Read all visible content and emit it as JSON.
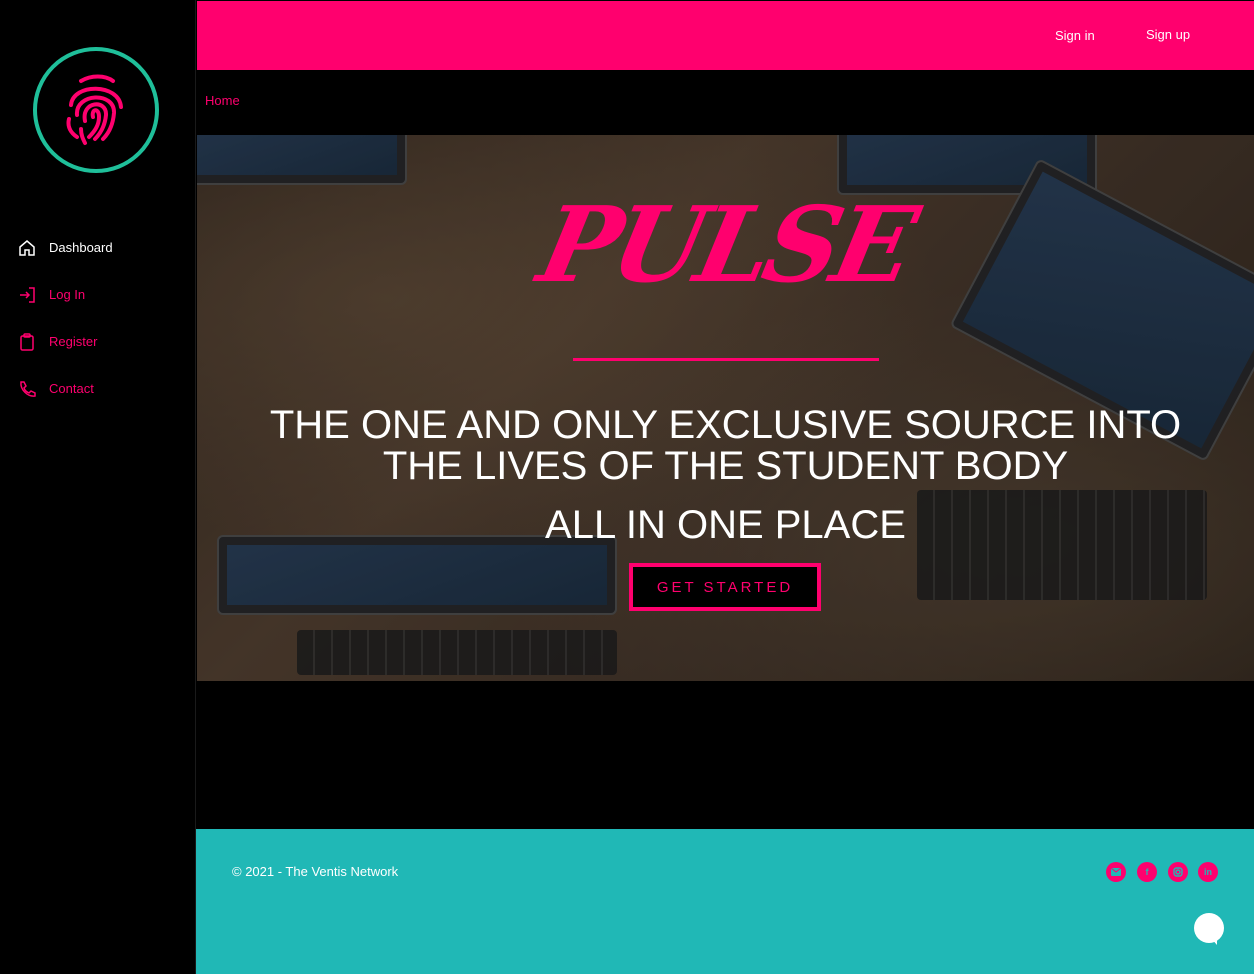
{
  "sidebar": {
    "logo_icon": "fingerprint-icon",
    "items": [
      {
        "label": "Dashboard",
        "icon": "home-icon",
        "active": true
      },
      {
        "label": "Log In",
        "icon": "login-icon"
      },
      {
        "label": "Register",
        "icon": "clipboard-icon"
      },
      {
        "label": "Contact",
        "icon": "phone-icon"
      }
    ]
  },
  "header": {
    "sign_in": "Sign in",
    "sign_up": "Sign up"
  },
  "breadcrumb": {
    "home": "Home"
  },
  "hero": {
    "brand": "PULSE",
    "headline_line1": "THE ONE AND ONLY EXCLUSIVE SOURCE INTO",
    "headline_line2": "THE LIVES OF THE STUDENT BODY",
    "subheadline": "ALL IN ONE PLACE",
    "cta": "GET STARTED"
  },
  "footer": {
    "copyright": "© 2021 - The Ventis Network",
    "social": [
      "mail-icon",
      "facebook-icon",
      "instagram-icon",
      "linkedin-icon"
    ]
  },
  "colors": {
    "accent": "#ff006e",
    "footer": "#20b8b6",
    "logo_ring": "#1fbf9a"
  }
}
